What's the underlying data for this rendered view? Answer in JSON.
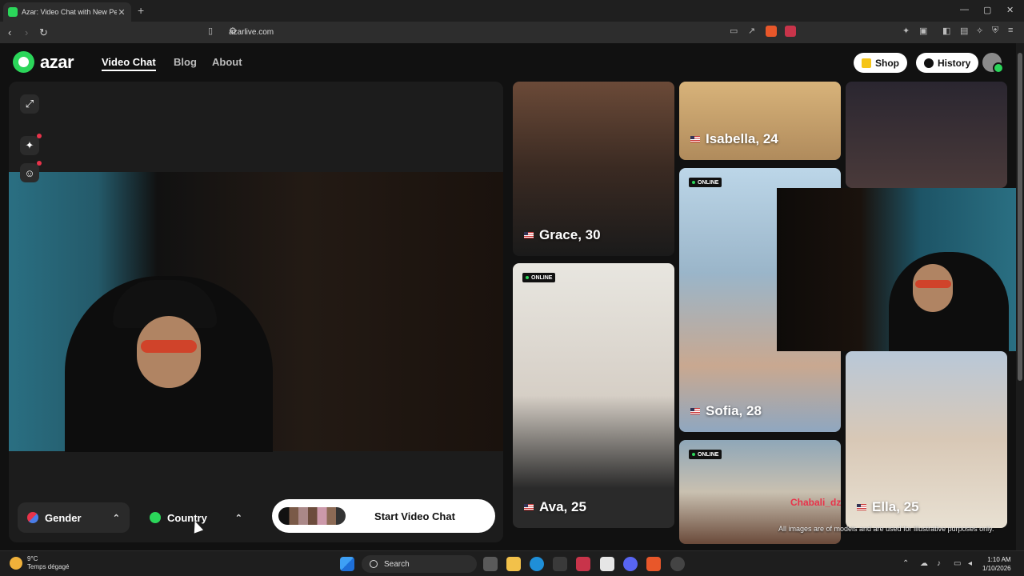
{
  "browser": {
    "tab_title": "Azar: Video Chat with New Pe",
    "tab_close": "✕",
    "new_tab": "+",
    "url": "azarlive.com",
    "window_controls": [
      "—",
      "▢",
      "✕"
    ]
  },
  "header": {
    "logo_text": "azar",
    "nav": [
      "Video Chat",
      "Blog",
      "About"
    ],
    "shop_label": "Shop",
    "history_label": "History"
  },
  "video_panel": {
    "filters": {
      "gender_label": "Gender",
      "country_label": "Country"
    },
    "start_label": "Start Video Chat"
  },
  "profiles": [
    {
      "name": "Grace, 30",
      "online": false
    },
    {
      "name": "Isabella, 24",
      "online": false
    },
    {
      "name": "Sofia, 28",
      "online": true
    },
    {
      "name": "Ava, 25",
      "online": true
    },
    {
      "name": "",
      "online": true
    },
    {
      "name": "Ella, 25",
      "online": false
    }
  ],
  "online_label": "ONLINE",
  "overlay_text": "Chabali_dz",
  "disclaimer": "All images are of models and are used for illustrative purposes only.",
  "taskbar": {
    "temperature": "9°C",
    "weather_desc": "Temps dégagé",
    "search_label": "Search",
    "time": "1:10 AM",
    "date": "1/10/2026"
  },
  "colors": {
    "brand_green": "#2bd65a",
    "notify_red": "#e8334a"
  }
}
